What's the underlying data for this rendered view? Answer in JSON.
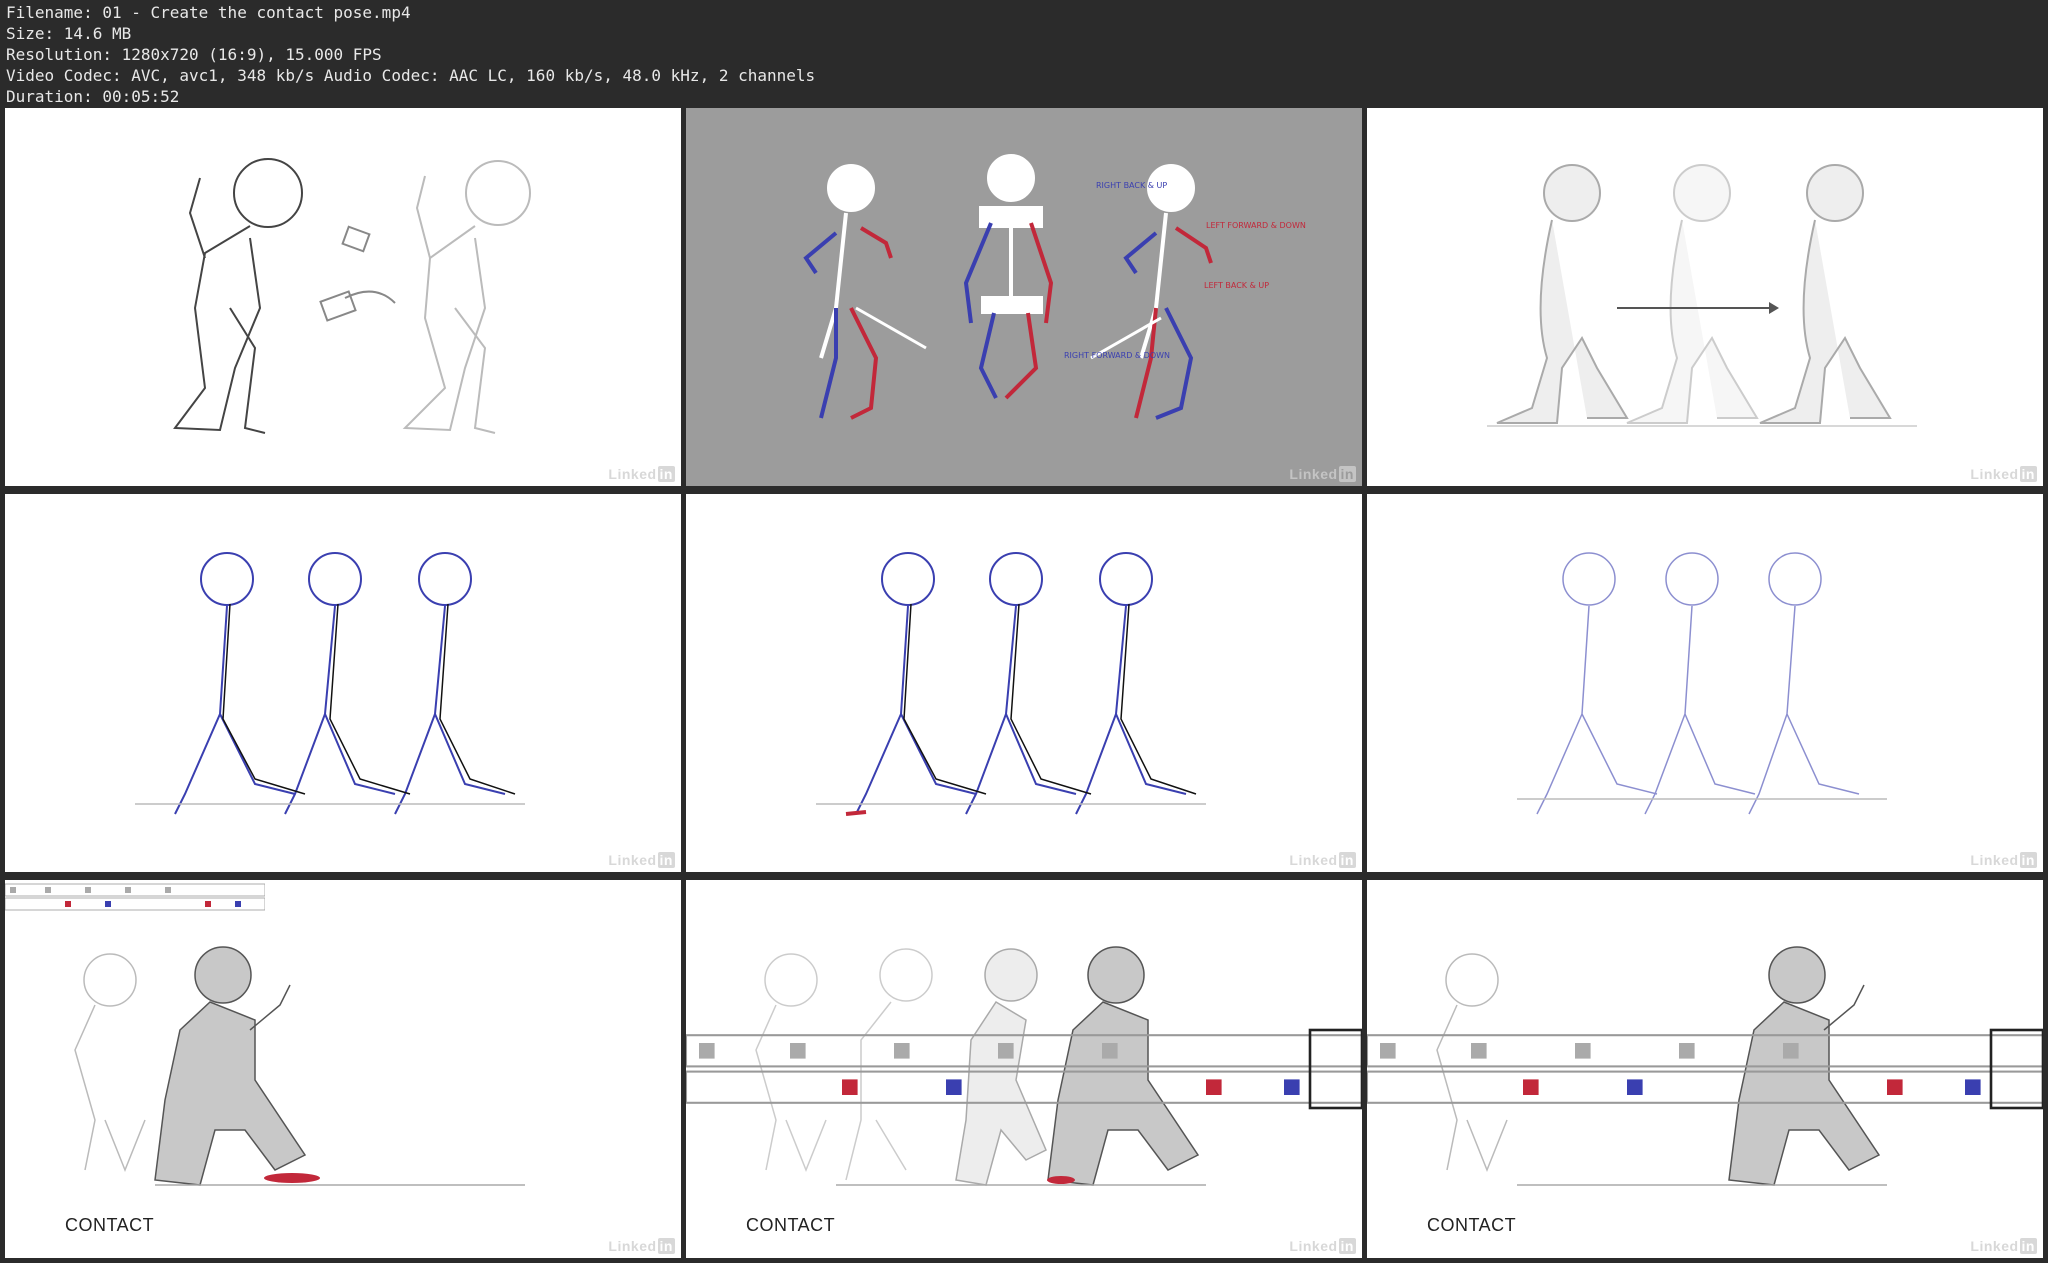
{
  "header": {
    "filename": "Filename: 01 - Create the contact pose.mp4",
    "size": "Size: 14.6 MB",
    "resolution": "Resolution: 1280x720 (16:9), 15.000 FPS",
    "codec": "Video Codec: AVC, avc1, 348 kb/s Audio Codec: AAC LC, 160 kb/s, 48.0 kHz, 2 channels",
    "duration": "Duration: 00:05:52"
  },
  "watermark": {
    "text": "Linked",
    "suffix": "in"
  },
  "thumbnails": [
    {
      "id": 1,
      "background": "#ffffff"
    },
    {
      "id": 2,
      "background": "#9c9c9c",
      "annotations": [
        "RIGHT BACK & UP",
        "LEFT FORWARD & DOWN",
        "LEFT BACK & UP",
        "RIGHT FORWARD & DOWN"
      ]
    },
    {
      "id": 3,
      "background": "#ffffff"
    },
    {
      "id": 4,
      "background": "#ffffff"
    },
    {
      "id": 5,
      "background": "#ffffff"
    },
    {
      "id": 6,
      "background": "#ffffff"
    },
    {
      "id": 7,
      "background": "#ffffff",
      "label": "CONTACT"
    },
    {
      "id": 8,
      "background": "#ffffff",
      "label": "CONTACT"
    },
    {
      "id": 9,
      "background": "#ffffff",
      "label": "CONTACT"
    }
  ],
  "colors": {
    "blue": "#3a3fb0",
    "red": "#c2283a",
    "ink": "#333333",
    "ghost": "#c8c8c8"
  }
}
